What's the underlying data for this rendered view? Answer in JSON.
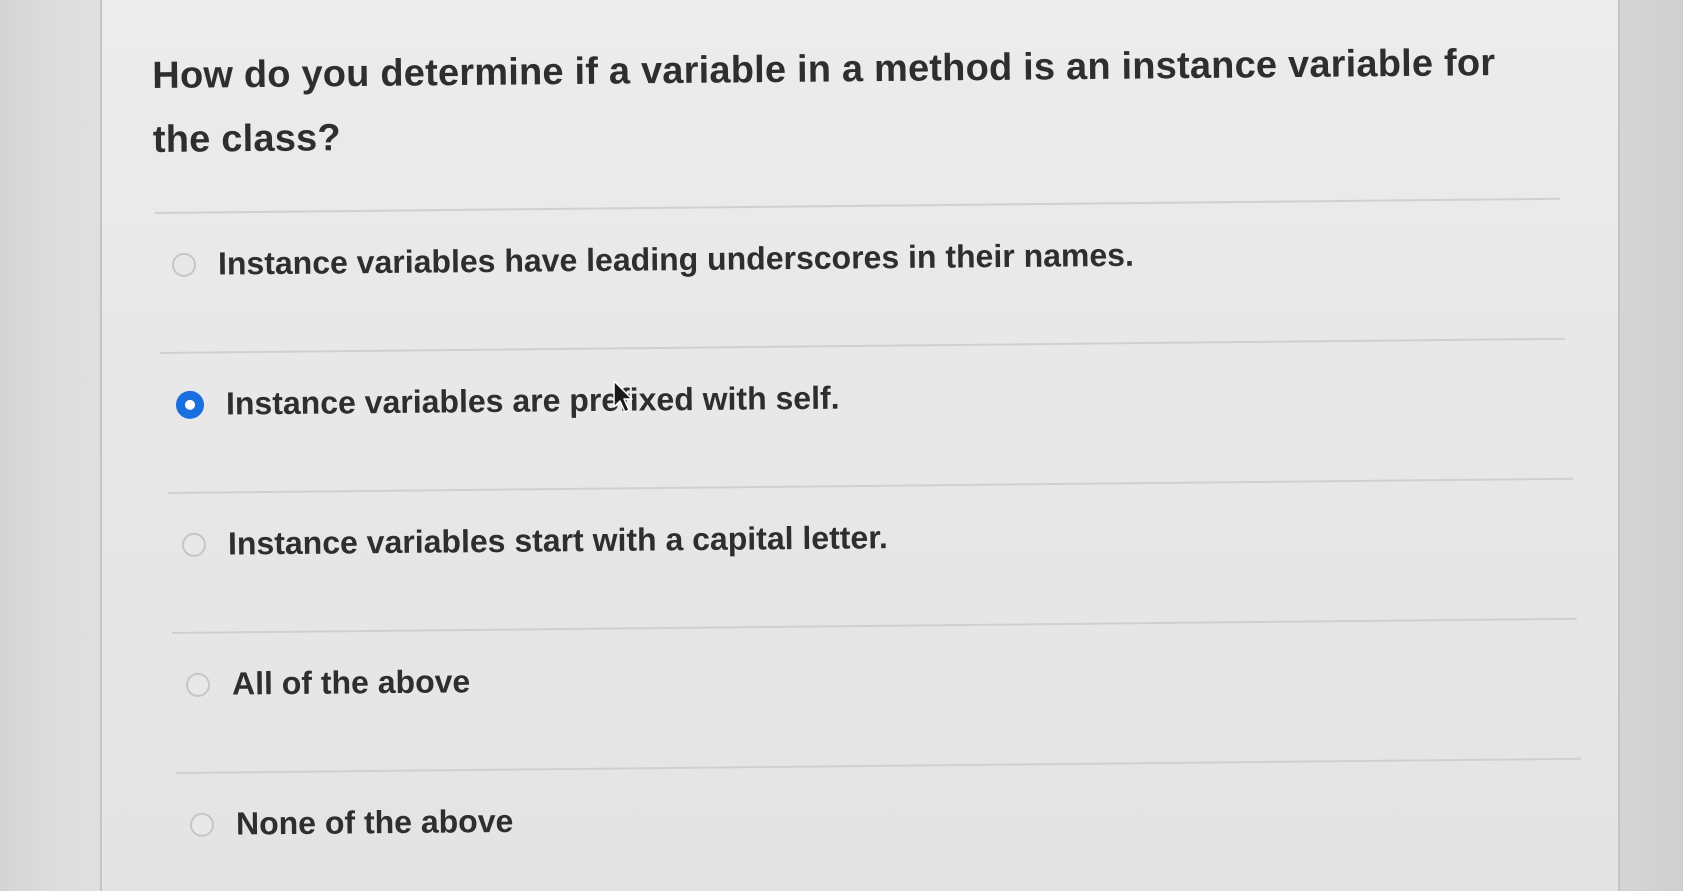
{
  "question": {
    "text": "How do you determine if a variable in a method is an instance variable for the class?"
  },
  "options": [
    {
      "label": "Instance variables have leading underscores in their names.",
      "selected": false
    },
    {
      "label": "Instance variables are prefixed with self.",
      "selected": true
    },
    {
      "label": "Instance variables start with a capital letter.",
      "selected": false
    },
    {
      "label": "All of the above",
      "selected": false
    },
    {
      "label": "None of the above",
      "selected": false
    }
  ],
  "colors": {
    "accent": "#1a6fe0",
    "text": "#2e2e2e"
  },
  "icons": {
    "cursor": "mouse-pointer-icon",
    "radio": "radio-button-icon"
  }
}
